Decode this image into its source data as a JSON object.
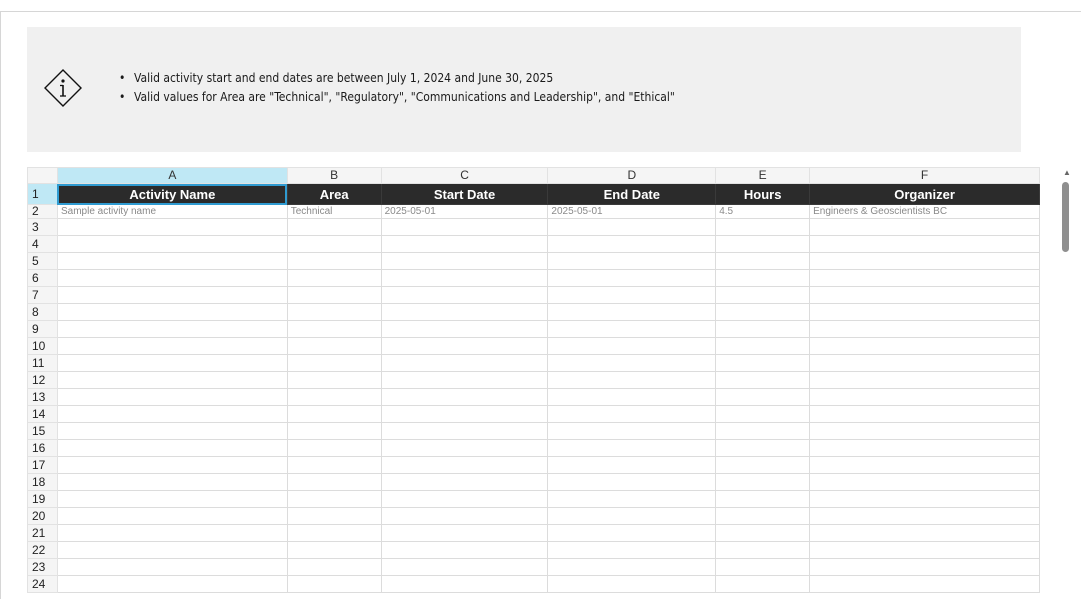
{
  "info": {
    "icon": "info-diamond-icon",
    "bullets": [
      "Valid activity start and end dates are between July 1, 2024 and June 30, 2025",
      "Valid values for Area are \"Technical\", \"Regulatory\", \"Communications and Leadership\", and \"Ethical\""
    ]
  },
  "sheet": {
    "column_letters": [
      "A",
      "B",
      "C",
      "D",
      "E",
      "F"
    ],
    "headers": [
      "Activity Name",
      "Area",
      "Start Date",
      "End Date",
      "Hours",
      "Organizer"
    ],
    "sample_row": [
      "Sample activity name",
      "Technical",
      "2025-05-01",
      "2025-05-01",
      "4.5",
      "Engineers & Geoscientists BC"
    ],
    "row_numbers": [
      "1",
      "2",
      "3",
      "4",
      "5",
      "6",
      "7",
      "8",
      "9",
      "10",
      "11",
      "12",
      "13",
      "14",
      "15",
      "16",
      "17",
      "18",
      "19",
      "20",
      "21",
      "22",
      "23",
      "24"
    ],
    "selected_column": "A",
    "selected_row": "1"
  },
  "colors": {
    "header_bg": "#2b2b2b",
    "selection": "#bfe8f5",
    "active_cell_border": "#2f9bd1"
  }
}
